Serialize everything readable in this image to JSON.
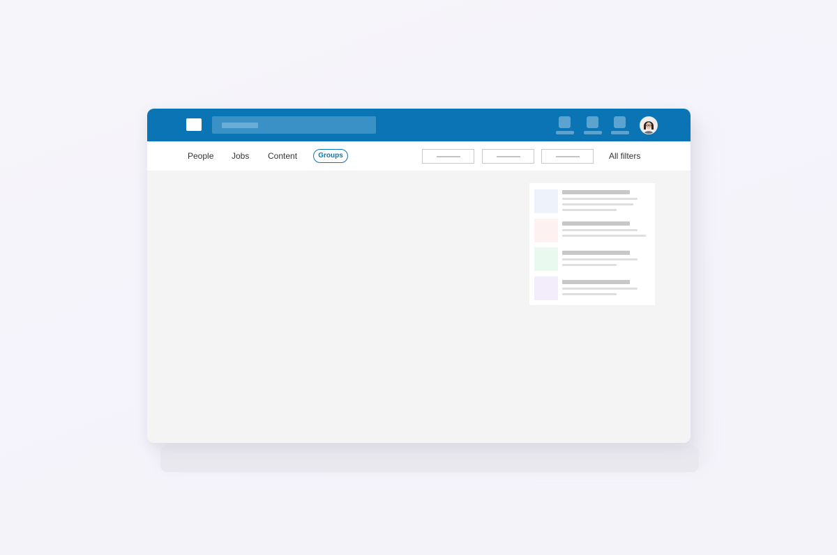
{
  "tabs": {
    "people": "People",
    "jobs": "Jobs",
    "content": "Content",
    "groups": "Groups"
  },
  "filters": {
    "all_filters_label": "All filters"
  },
  "colors": {
    "brand": "#0a74b5",
    "topbar_bg": "#0a74b5",
    "content_bg": "#f4f4f4",
    "card_bg": "#ffffff",
    "placeholder_line": "#c7c7c7"
  },
  "icons": {
    "logo": "logo-icon",
    "nav": [
      "nav-icon-1",
      "nav-icon-2",
      "nav-icon-3"
    ],
    "profile": "profile-avatar"
  },
  "sidebar_card": {
    "thumb_colors": [
      "#eef3fb",
      "#fdf1f2",
      "#e9f9ef",
      "#f3ecfb"
    ]
  }
}
